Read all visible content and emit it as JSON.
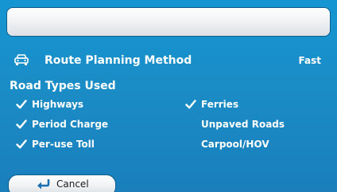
{
  "title_bar": {
    "text": ""
  },
  "route_planning": {
    "label": "Route Planning Method",
    "value": "Fast",
    "icon": "car-icon"
  },
  "road_types": {
    "title": "Road Types Used",
    "left": [
      {
        "label": "Highways",
        "checked": true
      },
      {
        "label": "Period Charge",
        "checked": true
      },
      {
        "label": "Per-use Toll",
        "checked": true
      }
    ],
    "right": [
      {
        "label": "Ferries",
        "checked": true
      },
      {
        "label": "Unpaved Roads",
        "checked": false
      },
      {
        "label": "Carpool/HOV",
        "checked": false
      }
    ]
  },
  "cancel_button": {
    "label": "Cancel",
    "icon": "return-arrow-icon"
  },
  "colors": {
    "background": "#1a8cc6",
    "text": "#ffffff",
    "button_text": "#1a1a1a",
    "icon_blue": "#1a6fb0"
  }
}
